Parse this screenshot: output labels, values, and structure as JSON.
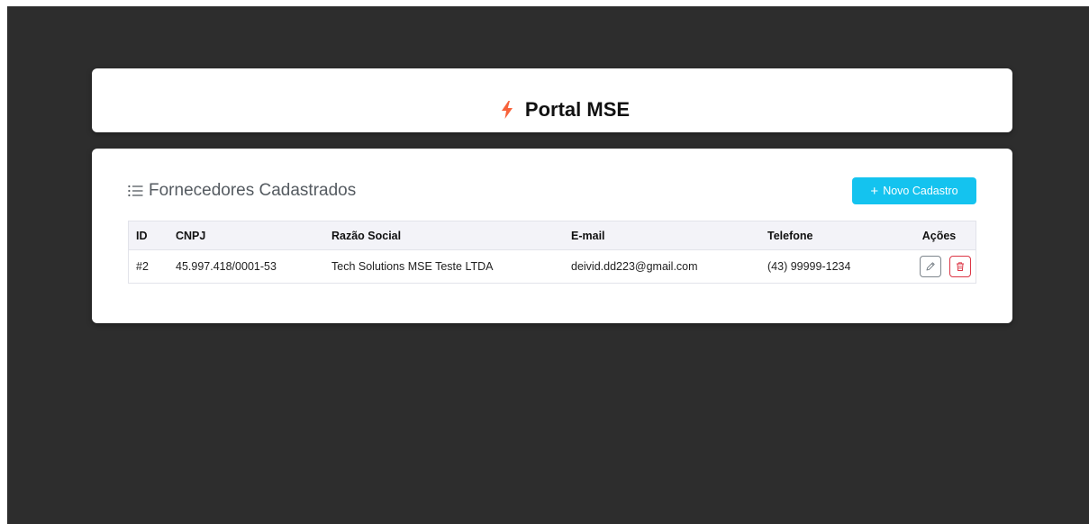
{
  "header": {
    "title": "Portal MSE",
    "icon": "lightning-bolt-icon",
    "icon_color": "#f7623b"
  },
  "section": {
    "title": "Fornecedores Cadastrados",
    "icon": "list-icon"
  },
  "new_button": {
    "label": "Novo Cadastro",
    "icon": "plus-icon",
    "color": "#14c3ef"
  },
  "table": {
    "columns": [
      "ID",
      "CNPJ",
      "Razão Social",
      "E-mail",
      "Telefone",
      "Ações"
    ],
    "rows": [
      {
        "id": "#2",
        "cnpj": "45.997.418/0001-53",
        "razao_social": "Tech Solutions MSE Teste LTDA",
        "email": "deivid.dd223@gmail.com",
        "telefone": "(43) 99999-1234",
        "actions": [
          "pencil-icon",
          "trash-icon"
        ]
      }
    ]
  },
  "colors": {
    "background": "#2d2d2d",
    "card": "#ffffff",
    "danger": "#dc3545"
  }
}
